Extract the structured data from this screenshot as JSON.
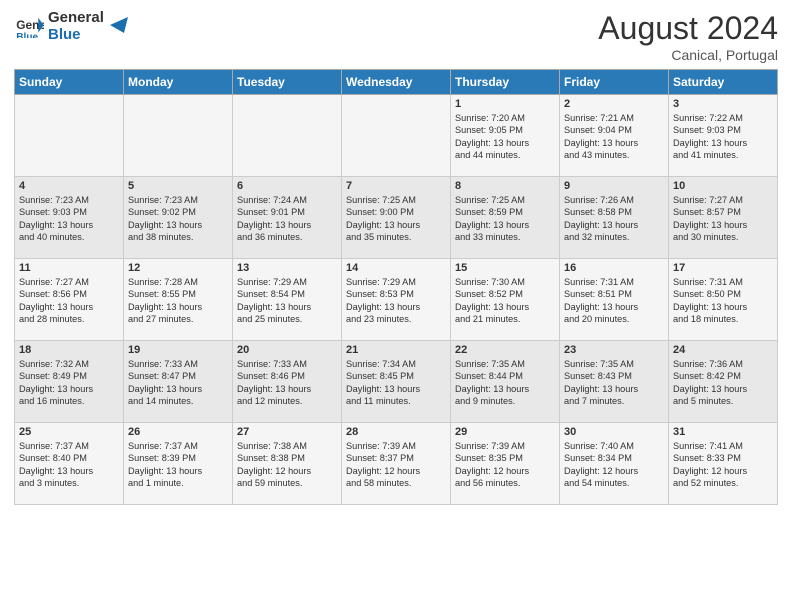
{
  "header": {
    "logo_general": "General",
    "logo_blue": "Blue",
    "main_title": "August 2024",
    "subtitle": "Canical, Portugal"
  },
  "days_of_week": [
    "Sunday",
    "Monday",
    "Tuesday",
    "Wednesday",
    "Thursday",
    "Friday",
    "Saturday"
  ],
  "weeks": [
    [
      {
        "day": "",
        "content": ""
      },
      {
        "day": "",
        "content": ""
      },
      {
        "day": "",
        "content": ""
      },
      {
        "day": "",
        "content": ""
      },
      {
        "day": "1",
        "content": "Sunrise: 7:20 AM\nSunset: 9:05 PM\nDaylight: 13 hours\nand 44 minutes."
      },
      {
        "day": "2",
        "content": "Sunrise: 7:21 AM\nSunset: 9:04 PM\nDaylight: 13 hours\nand 43 minutes."
      },
      {
        "day": "3",
        "content": "Sunrise: 7:22 AM\nSunset: 9:03 PM\nDaylight: 13 hours\nand 41 minutes."
      }
    ],
    [
      {
        "day": "4",
        "content": "Sunrise: 7:23 AM\nSunset: 9:03 PM\nDaylight: 13 hours\nand 40 minutes."
      },
      {
        "day": "5",
        "content": "Sunrise: 7:23 AM\nSunset: 9:02 PM\nDaylight: 13 hours\nand 38 minutes."
      },
      {
        "day": "6",
        "content": "Sunrise: 7:24 AM\nSunset: 9:01 PM\nDaylight: 13 hours\nand 36 minutes."
      },
      {
        "day": "7",
        "content": "Sunrise: 7:25 AM\nSunset: 9:00 PM\nDaylight: 13 hours\nand 35 minutes."
      },
      {
        "day": "8",
        "content": "Sunrise: 7:25 AM\nSunset: 8:59 PM\nDaylight: 13 hours\nand 33 minutes."
      },
      {
        "day": "9",
        "content": "Sunrise: 7:26 AM\nSunset: 8:58 PM\nDaylight: 13 hours\nand 32 minutes."
      },
      {
        "day": "10",
        "content": "Sunrise: 7:27 AM\nSunset: 8:57 PM\nDaylight: 13 hours\nand 30 minutes."
      }
    ],
    [
      {
        "day": "11",
        "content": "Sunrise: 7:27 AM\nSunset: 8:56 PM\nDaylight: 13 hours\nand 28 minutes."
      },
      {
        "day": "12",
        "content": "Sunrise: 7:28 AM\nSunset: 8:55 PM\nDaylight: 13 hours\nand 27 minutes."
      },
      {
        "day": "13",
        "content": "Sunrise: 7:29 AM\nSunset: 8:54 PM\nDaylight: 13 hours\nand 25 minutes."
      },
      {
        "day": "14",
        "content": "Sunrise: 7:29 AM\nSunset: 8:53 PM\nDaylight: 13 hours\nand 23 minutes."
      },
      {
        "day": "15",
        "content": "Sunrise: 7:30 AM\nSunset: 8:52 PM\nDaylight: 13 hours\nand 21 minutes."
      },
      {
        "day": "16",
        "content": "Sunrise: 7:31 AM\nSunset: 8:51 PM\nDaylight: 13 hours\nand 20 minutes."
      },
      {
        "day": "17",
        "content": "Sunrise: 7:31 AM\nSunset: 8:50 PM\nDaylight: 13 hours\nand 18 minutes."
      }
    ],
    [
      {
        "day": "18",
        "content": "Sunrise: 7:32 AM\nSunset: 8:49 PM\nDaylight: 13 hours\nand 16 minutes."
      },
      {
        "day": "19",
        "content": "Sunrise: 7:33 AM\nSunset: 8:47 PM\nDaylight: 13 hours\nand 14 minutes."
      },
      {
        "day": "20",
        "content": "Sunrise: 7:33 AM\nSunset: 8:46 PM\nDaylight: 13 hours\nand 12 minutes."
      },
      {
        "day": "21",
        "content": "Sunrise: 7:34 AM\nSunset: 8:45 PM\nDaylight: 13 hours\nand 11 minutes."
      },
      {
        "day": "22",
        "content": "Sunrise: 7:35 AM\nSunset: 8:44 PM\nDaylight: 13 hours\nand 9 minutes."
      },
      {
        "day": "23",
        "content": "Sunrise: 7:35 AM\nSunset: 8:43 PM\nDaylight: 13 hours\nand 7 minutes."
      },
      {
        "day": "24",
        "content": "Sunrise: 7:36 AM\nSunset: 8:42 PM\nDaylight: 13 hours\nand 5 minutes."
      }
    ],
    [
      {
        "day": "25",
        "content": "Sunrise: 7:37 AM\nSunset: 8:40 PM\nDaylight: 13 hours\nand 3 minutes."
      },
      {
        "day": "26",
        "content": "Sunrise: 7:37 AM\nSunset: 8:39 PM\nDaylight: 13 hours\nand 1 minute."
      },
      {
        "day": "27",
        "content": "Sunrise: 7:38 AM\nSunset: 8:38 PM\nDaylight: 12 hours\nand 59 minutes."
      },
      {
        "day": "28",
        "content": "Sunrise: 7:39 AM\nSunset: 8:37 PM\nDaylight: 12 hours\nand 58 minutes."
      },
      {
        "day": "29",
        "content": "Sunrise: 7:39 AM\nSunset: 8:35 PM\nDaylight: 12 hours\nand 56 minutes."
      },
      {
        "day": "30",
        "content": "Sunrise: 7:40 AM\nSunset: 8:34 PM\nDaylight: 12 hours\nand 54 minutes."
      },
      {
        "day": "31",
        "content": "Sunrise: 7:41 AM\nSunset: 8:33 PM\nDaylight: 12 hours\nand 52 minutes."
      }
    ]
  ]
}
